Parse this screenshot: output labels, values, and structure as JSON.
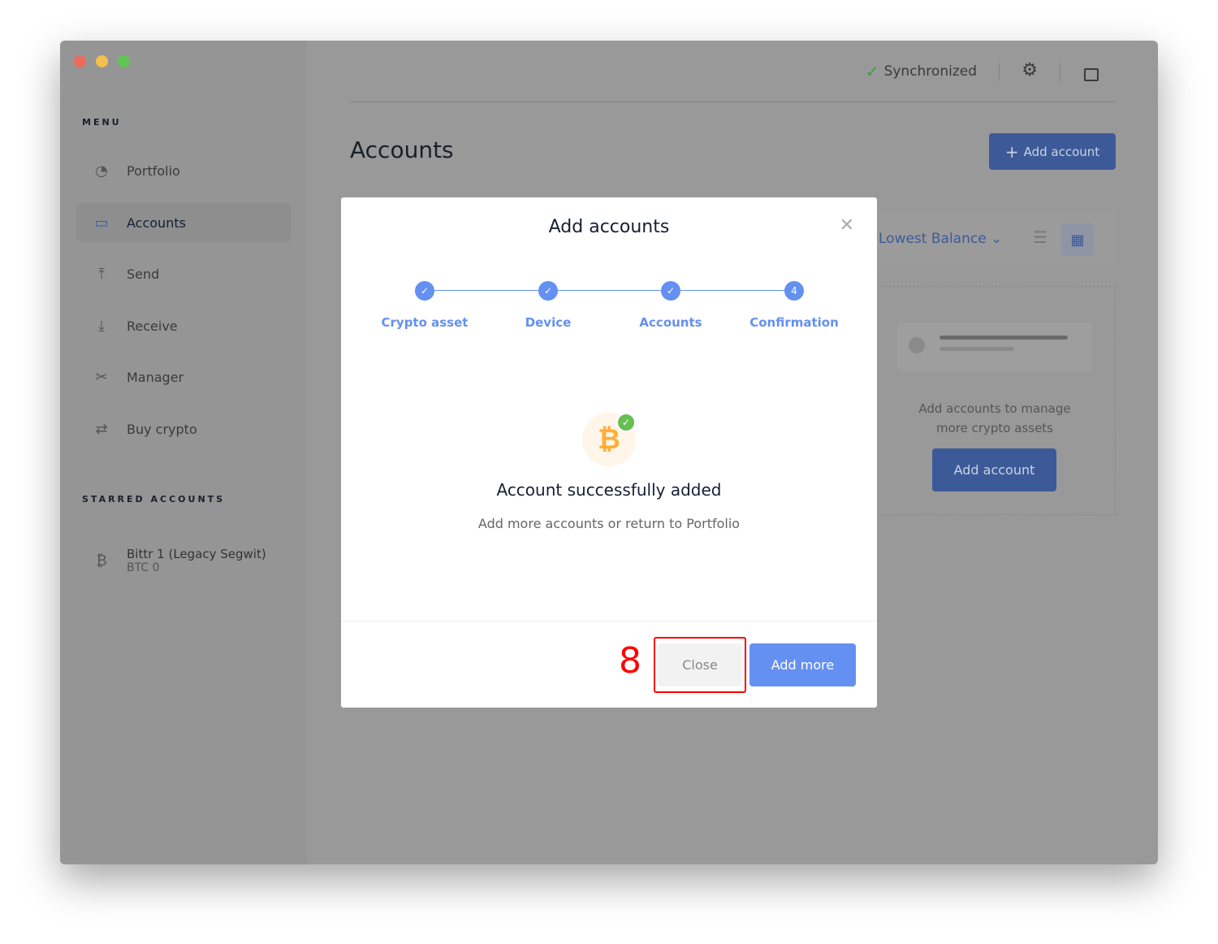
{
  "sidebar": {
    "menu_title": "MENU",
    "items": [
      {
        "label": "Portfolio",
        "icon": "pie-chart-icon"
      },
      {
        "label": "Accounts",
        "icon": "wallet-icon"
      },
      {
        "label": "Send",
        "icon": "upload-icon"
      },
      {
        "label": "Receive",
        "icon": "download-icon"
      },
      {
        "label": "Manager",
        "icon": "tools-icon"
      },
      {
        "label": "Buy crypto",
        "icon": "exchange-icon"
      }
    ],
    "starred_title": "STARRED ACCOUNTS",
    "starred": [
      {
        "name": "Bittr 1 (Legacy Segwit)",
        "balance": "BTC 0"
      }
    ]
  },
  "header": {
    "sync": "Synchronized"
  },
  "page": {
    "title": "Accounts",
    "add_account": "Add account",
    "sort": "Lowest Balance",
    "empty_text": "Add accounts to manage more crypto assets",
    "empty_button": "Add account"
  },
  "modal": {
    "title": "Add accounts",
    "steps": [
      "Crypto asset",
      "Device",
      "Accounts",
      "Confirmation"
    ],
    "step4_number": "4",
    "success_title": "Account successfully added",
    "success_sub": "Add more accounts or return to Portfolio",
    "close": "Close",
    "add_more": "Add more"
  },
  "annotation": {
    "label": "8"
  },
  "colors": {
    "accent": "#6490f1",
    "success": "#66be54",
    "bitcoin": "#ffae35",
    "annotation": "#ff0000"
  }
}
